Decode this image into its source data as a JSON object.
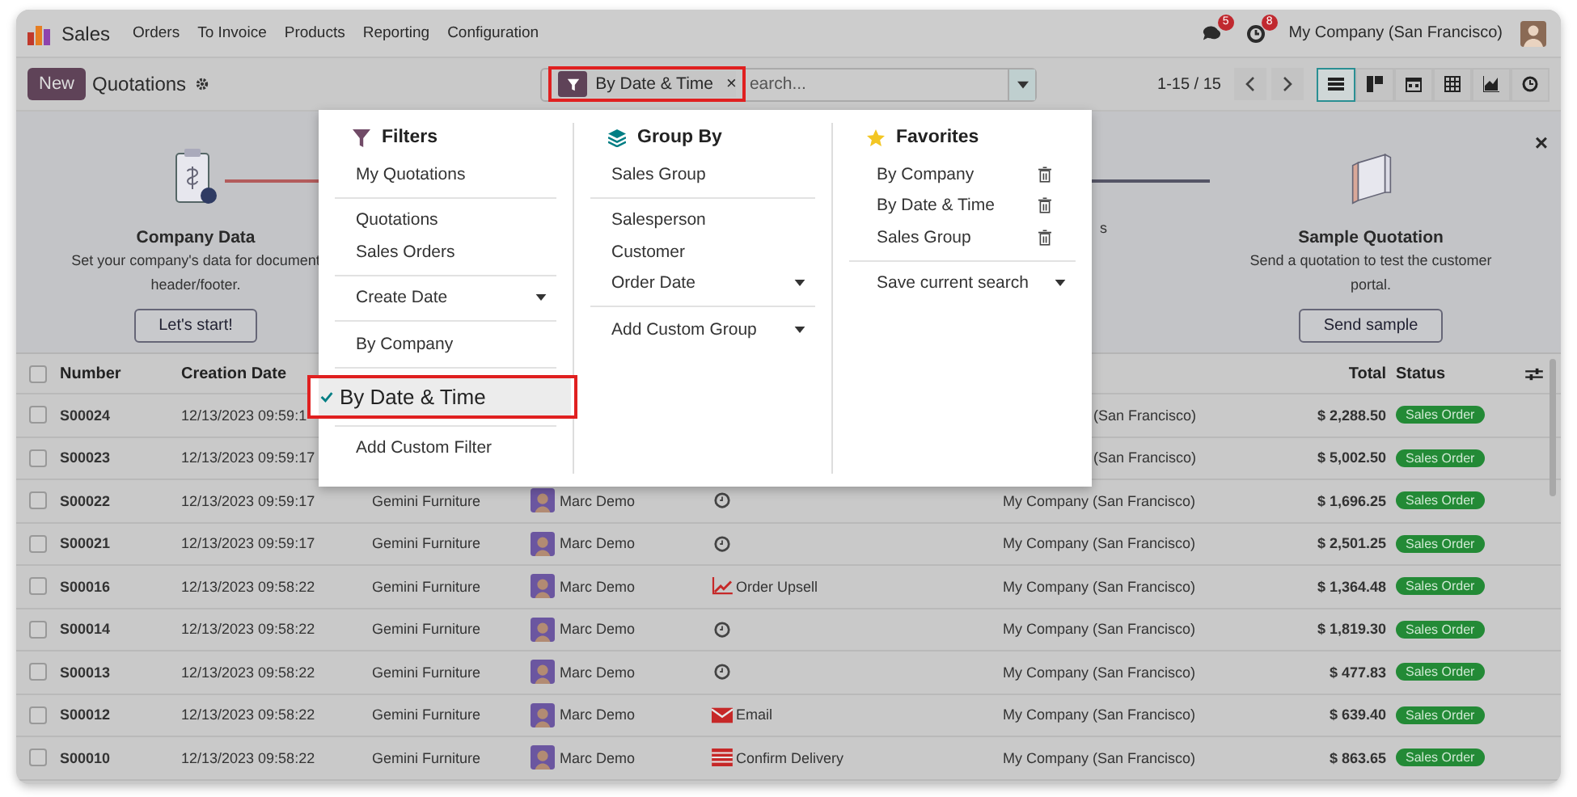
{
  "nav": {
    "app": "Sales",
    "menus": [
      "Orders",
      "To Invoice",
      "Products",
      "Reporting",
      "Configuration"
    ],
    "badges": [
      {
        "kind": "messages",
        "count": "5"
      },
      {
        "kind": "activities",
        "count": "8"
      }
    ],
    "company": "My Company (San Francisco)"
  },
  "control_panel": {
    "new_button": "New",
    "title": "Quotations",
    "facets": [
      {
        "label": "By Date & Time",
        "remove": "×"
      }
    ],
    "search_placeholder": "earch...",
    "pager": "1-15 / 15",
    "views": [
      {
        "kind": "list",
        "selected": true
      },
      {
        "kind": "kanban",
        "selected": false
      },
      {
        "kind": "calendar",
        "selected": false
      },
      {
        "kind": "pivot",
        "selected": false
      },
      {
        "kind": "graph",
        "selected": false
      },
      {
        "kind": "activity",
        "selected": false
      }
    ]
  },
  "onboarding": {
    "close": "×",
    "steps": [
      {
        "kind": "company",
        "title": "Company Data",
        "lines": [
          "Set your company's data for document",
          "header/footer."
        ],
        "button": "Let's start!"
      },
      {
        "kind": "hidden",
        "lines": [
          "s"
        ]
      },
      {
        "kind": "sample",
        "title": "Sample Quotation",
        "lines": [
          "Send a quotation to test the customer",
          "portal."
        ],
        "button": "Send sample"
      }
    ]
  },
  "search_panel": {
    "filters": {
      "title": "Filters",
      "groups": [
        [
          {
            "label": "My Quotations",
            "selected": false,
            "submenu": false
          }
        ],
        [
          {
            "label": "Quotations",
            "selected": false,
            "submenu": false
          },
          {
            "label": "Sales Orders",
            "selected": false,
            "submenu": false
          }
        ],
        [
          {
            "label": "Create Date",
            "selected": false,
            "submenu": true
          }
        ],
        [
          {
            "label": "By Company",
            "selected": false,
            "submenu": false
          }
        ],
        [
          {
            "label": "By Date & Time",
            "selected": true,
            "submenu": false
          }
        ],
        [
          {
            "label": "Add Custom Filter",
            "selected": false,
            "submenu": false
          }
        ]
      ]
    },
    "group_by": {
      "title": "Group By",
      "groups": [
        [
          {
            "label": "Sales Group",
            "selected": false,
            "submenu": false
          }
        ],
        [
          {
            "label": "Salesperson",
            "selected": false,
            "submenu": false
          },
          {
            "label": "Customer",
            "selected": false,
            "submenu": false
          },
          {
            "label": "Order Date",
            "selected": false,
            "submenu": true
          }
        ],
        [
          {
            "label": "Add Custom Group",
            "selected": false,
            "submenu": true
          }
        ]
      ]
    },
    "favorites": {
      "title": "Favorites",
      "items": [
        {
          "label": "By Company"
        },
        {
          "label": "By Date & Time"
        },
        {
          "label": "Sales Group"
        }
      ],
      "save": "Save current search"
    }
  },
  "table": {
    "headers": {
      "number": "Number",
      "creation_date": "Creation Date",
      "total": "Total",
      "status": "Status"
    },
    "all_checked": false,
    "rows": [
      {
        "checked": false,
        "number": "S00024",
        "creation_date": "12/13/2023 09:59:1",
        "company": "(San Francisco)",
        "total": "$ 2,288.50",
        "status": "Sales Order"
      },
      {
        "checked": false,
        "number": "S00023",
        "creation_date": "12/13/2023 09:59:17",
        "company": "(San Francisco)",
        "total": "$ 5,002.50",
        "status": "Sales Order"
      },
      {
        "checked": false,
        "number": "S00022",
        "creation_date": "12/13/2023 09:59:17",
        "customer": "Gemini Furniture",
        "salesperson": "Marc Demo",
        "activity": {
          "kind": "clock"
        },
        "company": "My Company (San Francisco)",
        "total": "$ 1,696.25",
        "status": "Sales Order"
      },
      {
        "checked": false,
        "number": "S00021",
        "creation_date": "12/13/2023 09:59:17",
        "customer": "Gemini Furniture",
        "salesperson": "Marc Demo",
        "activity": {
          "kind": "clock"
        },
        "company": "My Company (San Francisco)",
        "total": "$ 2,501.25",
        "status": "Sales Order"
      },
      {
        "checked": false,
        "number": "S00016",
        "creation_date": "12/13/2023 09:58:22",
        "customer": "Gemini Furniture",
        "salesperson": "Marc Demo",
        "activity": {
          "kind": "upsell",
          "label": "Order Upsell"
        },
        "company": "My Company (San Francisco)",
        "total": "$ 1,364.48",
        "status": "Sales Order"
      },
      {
        "checked": false,
        "number": "S00014",
        "creation_date": "12/13/2023 09:58:22",
        "customer": "Gemini Furniture",
        "salesperson": "Marc Demo",
        "activity": {
          "kind": "clock"
        },
        "company": "My Company (San Francisco)",
        "total": "$ 1,819.30",
        "status": "Sales Order"
      },
      {
        "checked": false,
        "number": "S00013",
        "creation_date": "12/13/2023 09:58:22",
        "customer": "Gemini Furniture",
        "salesperson": "Marc Demo",
        "activity": {
          "kind": "clock"
        },
        "company": "My Company (San Francisco)",
        "total": "$ 477.83",
        "status": "Sales Order"
      },
      {
        "checked": false,
        "number": "S00012",
        "creation_date": "12/13/2023 09:58:22",
        "customer": "Gemini Furniture",
        "salesperson": "Marc Demo",
        "activity": {
          "kind": "email",
          "label": "Email"
        },
        "company": "My Company (San Francisco)",
        "total": "$ 639.40",
        "status": "Sales Order"
      },
      {
        "checked": false,
        "number": "S00010",
        "creation_date": "12/13/2023 09:58:22",
        "customer": "Gemini Furniture",
        "salesperson": "Marc Demo",
        "activity": {
          "kind": "delivery",
          "label": "Confirm Delivery"
        },
        "company": "My Company (San Francisco)",
        "total": "$ 863.65",
        "status": "Sales Order"
      }
    ]
  }
}
